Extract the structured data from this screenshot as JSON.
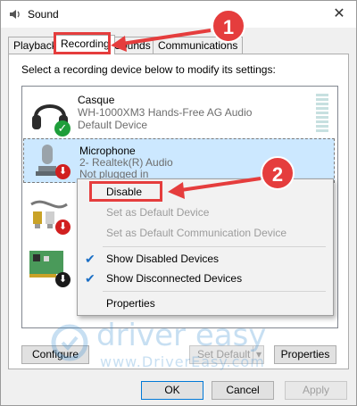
{
  "window": {
    "title": "Sound",
    "close_label": "✕"
  },
  "tabs": [
    {
      "label": "Playback",
      "active": false
    },
    {
      "label": "Recording",
      "active": true
    },
    {
      "label": "Sounds",
      "active": false
    },
    {
      "label": "Communications",
      "active": false
    }
  ],
  "instruction": "Select a recording device below to modify its settings:",
  "devices": [
    {
      "name": "Casque",
      "subtitle": "WH-1000XM3 Hands-Free AG Audio",
      "status": "Default Device",
      "icon": "headset-icon",
      "badge": "check"
    },
    {
      "name": "Microphone",
      "subtitle": "2- Realtek(R) Audio",
      "status": "Not plugged in",
      "icon": "microphone-icon",
      "badge": "down-arrow"
    },
    {
      "name": "",
      "subtitle": "",
      "status": "",
      "icon": "audio-cable-icon",
      "badge": "down-arrow"
    },
    {
      "name": "",
      "subtitle": "",
      "status": "",
      "icon": "sound-card-icon",
      "badge": "down-arrow"
    }
  ],
  "context_menu": {
    "disable": "Disable",
    "set_default": "Set as Default Device",
    "set_default_comm": "Set as Default Communication Device",
    "show_disabled": "Show Disabled Devices",
    "show_disconnected": "Show Disconnected Devices",
    "properties": "Properties"
  },
  "panel_buttons": {
    "configure": "Configure",
    "set_default": "Set Default",
    "properties": "Properties"
  },
  "dialog_buttons": {
    "ok": "OK",
    "cancel": "Cancel",
    "apply": "Apply"
  },
  "annotations": {
    "step1": "1",
    "step2": "2"
  },
  "watermark": {
    "brand": "driver easy",
    "url": "www.DriverEasy.com"
  },
  "colors": {
    "accent": "#e53d3d",
    "selection": "#cce8ff",
    "check": "#1b6fc5",
    "green_badge": "#1e9e3a",
    "red_badge": "#d11f1f"
  }
}
